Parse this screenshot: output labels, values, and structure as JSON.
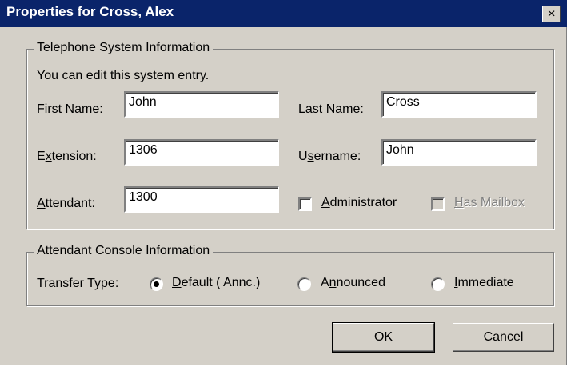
{
  "window": {
    "title": "Properties for Cross, Alex",
    "close_glyph": "×"
  },
  "telephone_group": {
    "title": "Telephone System Information",
    "info": "You can edit this system entry.",
    "first_name": {
      "mnemonic": "F",
      "rest": "irst Name:",
      "value": "John"
    },
    "last_name": {
      "mnemonic": "L",
      "rest": "ast Name:",
      "value": "Cross"
    },
    "extension": {
      "pre": "E",
      "mnemonic": "x",
      "rest": "tension:",
      "value": "1306"
    },
    "username": {
      "pre": "U",
      "mnemonic": "s",
      "rest": "ername:",
      "value": "John"
    },
    "attendant": {
      "mnemonic": "A",
      "rest": "ttendant:",
      "value": "1300"
    },
    "administrator": {
      "mnemonic": "A",
      "rest": "dministrator",
      "checked": false
    },
    "has_mailbox": {
      "mnemonic": "H",
      "rest": "as Mailbox",
      "checked": false,
      "enabled": false
    }
  },
  "console_group": {
    "title": "Attendant Console Information",
    "transfer_label": "Transfer Type:",
    "options": {
      "default": {
        "mnemonic": "D",
        "rest": "efault ( Annc.)",
        "selected": true
      },
      "announced": {
        "pre": "A",
        "mnemonic": "n",
        "rest": "nounced",
        "selected": false
      },
      "immediate": {
        "mnemonic": "I",
        "rest": "mmediate",
        "selected": false
      }
    }
  },
  "buttons": {
    "ok": "OK",
    "cancel": "Cancel"
  },
  "colors": {
    "titlebar": "#0a246a",
    "face": "#d4d0c8"
  }
}
